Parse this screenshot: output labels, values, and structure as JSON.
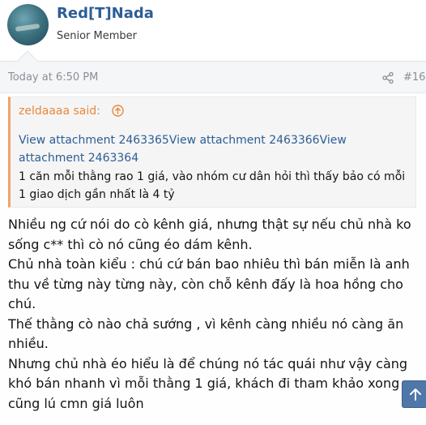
{
  "user": {
    "name": "Red[T]Nada",
    "title": "Senior Member"
  },
  "post": {
    "time": "Today at 6:50 PM",
    "number": "#16"
  },
  "quote": {
    "author_label": "zeldaaaa said:",
    "links": "View attachment 2463365View attachment 2463366View attachment 2463364",
    "text": "1 căn mỗi thằng rao 1 giá, vào nhóm cư dân hỏi thì thấy bảo có mỗi 1 giao dịch gần nhất là 4 tỷ"
  },
  "body": {
    "p1": "Nhiều ng cứ nói do cò kênh giá, nhưng thật sự nếu chủ nhà ko sống c** thì cò nó cũng éo dám kênh.",
    "p2": "Chủ nhà toàn kiểu : chú cứ bán bao nhiêu thì bán miễn là anh thu về từng này từng này, còn chỗ kênh đấy là hoa hồng cho chú.",
    "p3": "Thế thằng cò nào chả sướng , vì kênh càng nhiều nó càng ăn nhiều.",
    "p4": "Nhưng chủ nhà éo hiểu là để chúng nó tác quái như vậy càng khó bán nhanh vì mỗi thằng 1 giá, khách đi tham khảo xong cũng lú cmn giá luôn"
  },
  "icons": {
    "share": "share-icon",
    "quote_jump": "arrow-up-circle-icon",
    "scroll_top": "arrow-up-icon"
  },
  "colors": {
    "username": "#2c5d96",
    "quote_accent": "#f0a26c",
    "link": "#2c5d96",
    "scroll_button": "#4f77a8"
  }
}
